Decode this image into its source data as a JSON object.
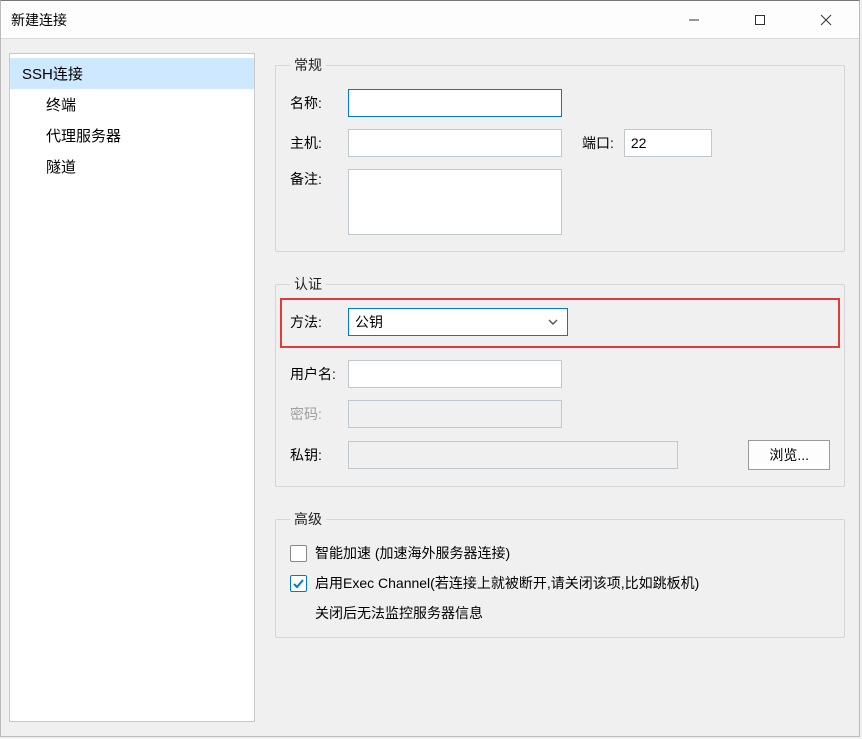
{
  "window": {
    "title": "新建连接"
  },
  "sidebar": {
    "items": [
      {
        "label": "SSH连接",
        "selected": true
      },
      {
        "label": "终端"
      },
      {
        "label": "代理服务器"
      },
      {
        "label": "隧道"
      }
    ]
  },
  "groups": {
    "general": {
      "legend": "常规",
      "name_label": "名称:",
      "name_value": "",
      "host_label": "主机:",
      "host_value": "",
      "port_label": "端口:",
      "port_value": "22",
      "remark_label": "备注:",
      "remark_value": ""
    },
    "auth": {
      "legend": "认证",
      "method_label": "方法:",
      "method_value": "公钥",
      "username_label": "用户名:",
      "username_value": "",
      "password_label": "密码:",
      "password_value": "",
      "privatekey_label": "私钥:",
      "privatekey_value": "",
      "browse_label": "浏览..."
    },
    "advanced": {
      "legend": "高级",
      "smart_label": "智能加速 (加速海外服务器连接)",
      "exec_label": "启用Exec Channel(若连接上就被断开,请关闭该项,比如跳板机)",
      "exec_note": "关闭后无法监控服务器信息",
      "smart_checked": false,
      "exec_checked": true
    }
  }
}
